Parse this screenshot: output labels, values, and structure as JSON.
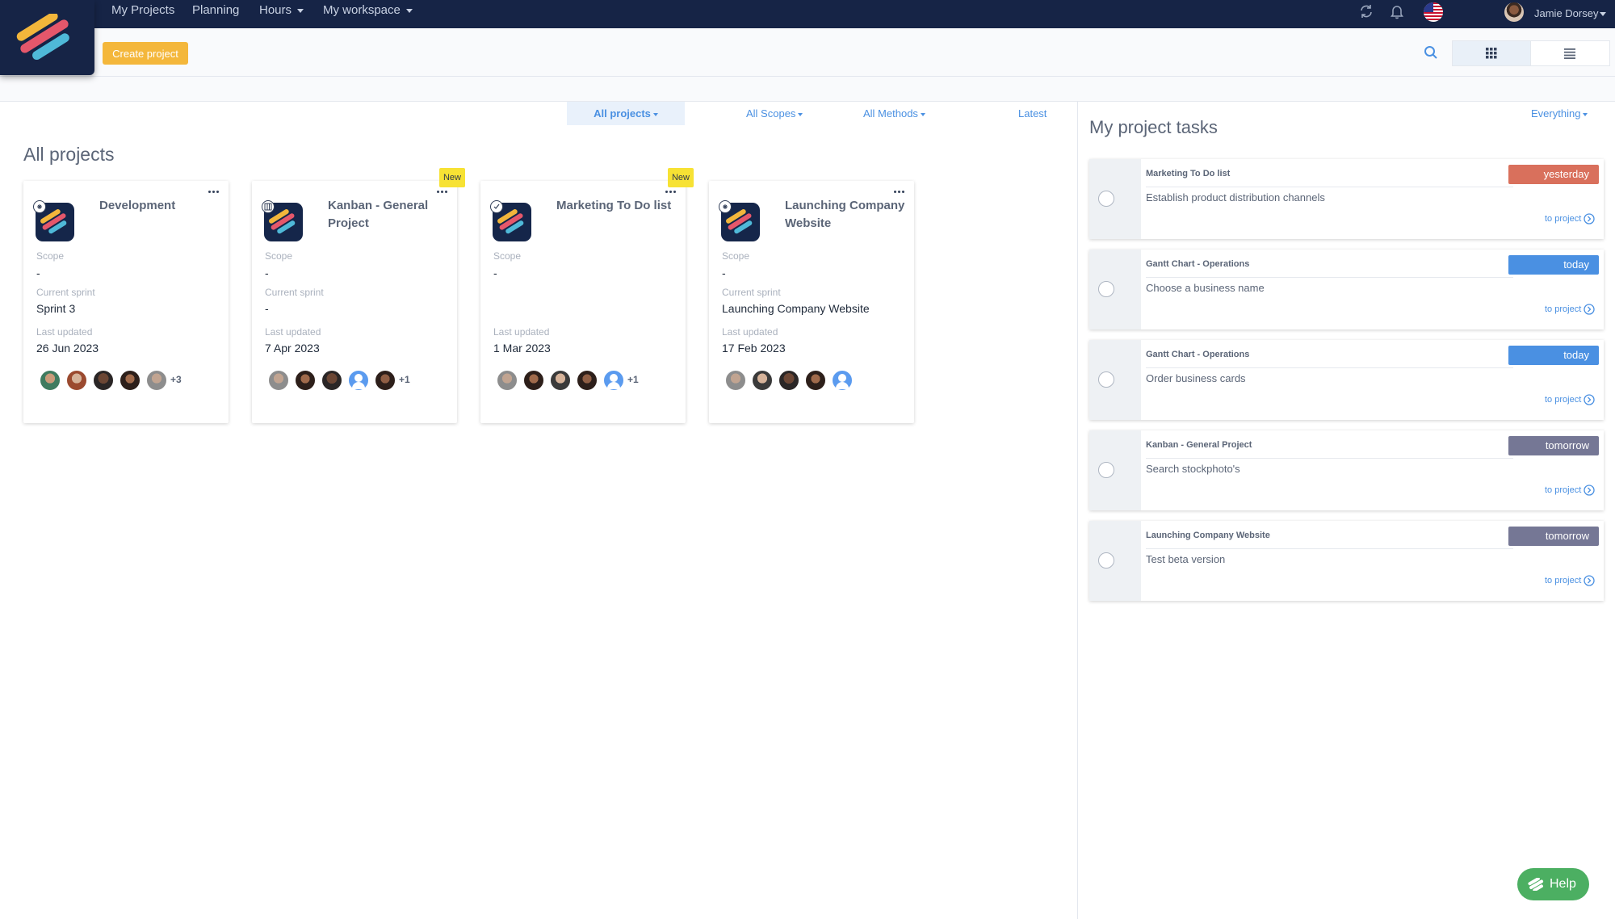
{
  "nav": {
    "items": [
      "My Projects",
      "Planning",
      "Hours",
      "My workspace"
    ],
    "user_name": "Jamie Dorsey"
  },
  "toolbar": {
    "create_label": "Create project"
  },
  "filters": {
    "projects": "All projects",
    "scopes": "All Scopes",
    "methods": "All Methods",
    "sort": "Latest"
  },
  "projects": {
    "title": "All projects",
    "labels": {
      "scope": "Scope",
      "sprint": "Current sprint",
      "updated": "Last updated",
      "new": "New"
    },
    "cards": [
      {
        "title": "Development",
        "scope": "-",
        "sprint": "Sprint 3",
        "updated": "26 Jun 2023",
        "more": "+3"
      },
      {
        "title": "Kanban - General Project",
        "scope": "-",
        "sprint": "-",
        "updated": "7 Apr 2023",
        "more": "+1"
      },
      {
        "title": "Marketing To Do list",
        "scope": "-",
        "sprint": "",
        "updated": "1 Mar 2023",
        "more": "+1"
      },
      {
        "title": "Launching Company Website",
        "scope": "-",
        "sprint": "Launching Company Website",
        "updated": "17 Feb 2023",
        "more": ""
      }
    ]
  },
  "tasks": {
    "title": "My project tasks",
    "filter": "Everything",
    "to_project": "to project",
    "badge_colors": {
      "yesterday": "#d9705c",
      "today": "#4a90e2",
      "tomorrow": "#757795"
    },
    "items": [
      {
        "project": "Marketing To Do list",
        "name": "Establish product distribution channels",
        "due": "yesterday"
      },
      {
        "project": "Gantt Chart - Operations",
        "name": "Choose a business name",
        "due": "today"
      },
      {
        "project": "Gantt Chart - Operations",
        "name": "Order business cards",
        "due": "today"
      },
      {
        "project": "Kanban - General Project",
        "name": "Search stockphoto's",
        "due": "tomorrow"
      },
      {
        "project": "Launching Company Website",
        "name": "Test beta version",
        "due": "tomorrow"
      }
    ]
  },
  "help": {
    "label": "Help"
  },
  "icons": {
    "refresh": "refresh-icon",
    "bell": "bell-icon",
    "flag": "us-flag-icon",
    "search": "search-icon",
    "grid": "grid-view-icon",
    "list": "list-view-icon"
  },
  "colors": {
    "nav_bg": "#162446",
    "accent": "#4a90e2",
    "create_button": "#f4b73b",
    "help_button": "#4caf62"
  }
}
